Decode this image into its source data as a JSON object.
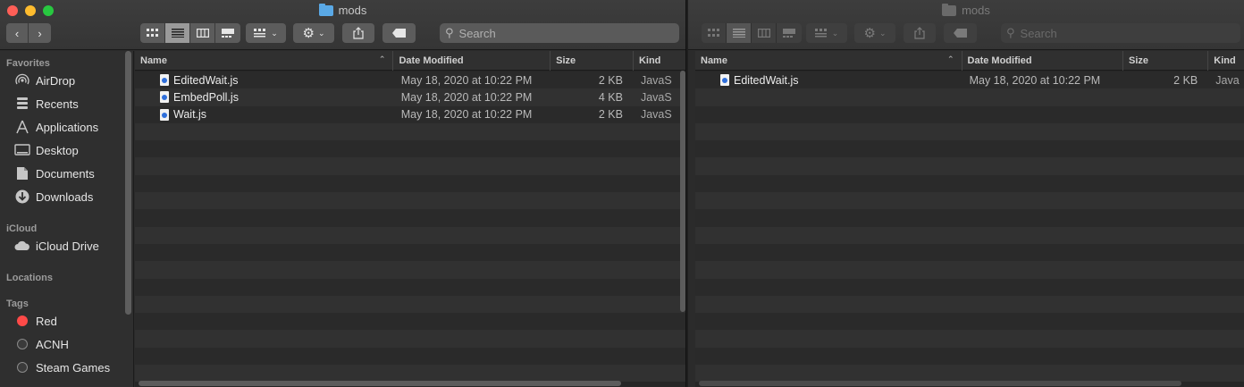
{
  "left": {
    "title": "mods",
    "search_placeholder": "Search",
    "sidebar": {
      "favorites_label": "Favorites",
      "favorites": [
        {
          "label": "AirDrop",
          "icon": "airdrop-icon"
        },
        {
          "label": "Recents",
          "icon": "recents-icon"
        },
        {
          "label": "Applications",
          "icon": "applications-icon"
        },
        {
          "label": "Desktop",
          "icon": "desktop-icon"
        },
        {
          "label": "Documents",
          "icon": "documents-icon"
        },
        {
          "label": "Downloads",
          "icon": "downloads-icon"
        }
      ],
      "icloud_label": "iCloud",
      "icloud": [
        {
          "label": "iCloud Drive",
          "icon": "cloud-icon"
        }
      ],
      "locations_label": "Locations",
      "tags_label": "Tags",
      "tags": [
        {
          "label": "Red",
          "color": "#fe4a48"
        },
        {
          "label": "ACNH",
          "color": "#3a3a3a"
        },
        {
          "label": "Steam Games",
          "color": "#3a3a3a"
        }
      ]
    },
    "columns": {
      "name": "Name",
      "date": "Date Modified",
      "size": "Size",
      "kind": "Kind"
    },
    "files": [
      {
        "name": "EditedWait.js",
        "date": "May 18, 2020 at 10:22 PM",
        "size": "2 KB",
        "kind": "JavaS"
      },
      {
        "name": "EmbedPoll.js",
        "date": "May 18, 2020 at 10:22 PM",
        "size": "4 KB",
        "kind": "JavaS"
      },
      {
        "name": "Wait.js",
        "date": "May 18, 2020 at 10:22 PM",
        "size": "2 KB",
        "kind": "JavaS"
      }
    ]
  },
  "right": {
    "title": "mods",
    "search_placeholder": "Search",
    "columns": {
      "name": "Name",
      "date": "Date Modified",
      "size": "Size",
      "kind": "Kind"
    },
    "files": [
      {
        "name": "EditedWait.js",
        "date": "May 18, 2020 at 10:22 PM",
        "size": "2 KB",
        "kind": "Java"
      }
    ]
  }
}
